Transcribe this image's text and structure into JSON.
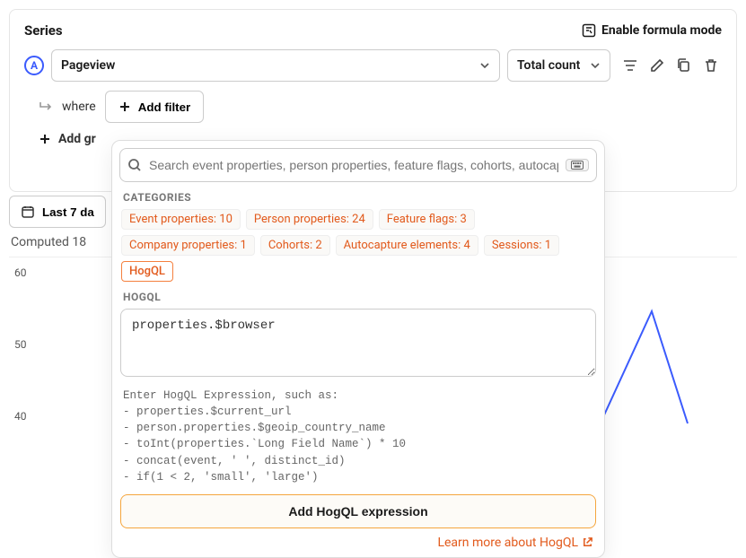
{
  "panel": {
    "title": "Series",
    "formula_link": "Enable formula mode"
  },
  "series": {
    "badge": "A",
    "event": "Pageview",
    "aggregate": "Total count"
  },
  "filter": {
    "where_label": "where",
    "add_filter_label": "Add filter",
    "add_group_label": "Add gr"
  },
  "popover": {
    "search_placeholder": "Search event properties, person properties, feature flags, cohorts, autocap",
    "categories_label": "CATEGORIES",
    "chips": [
      "Event properties: 10",
      "Person properties: 24",
      "Feature flags: 3",
      "Company properties: 1",
      "Cohorts: 2",
      "Autocapture elements: 4",
      "Sessions: 1",
      "HogQL"
    ],
    "active_chip_index": 7,
    "hogql_label": "HOGQL",
    "hogql_value": "properties.$browser",
    "hint": "Enter HogQL Expression, such as:\n- properties.$current_url\n- person.properties.$geoip_country_name\n- toInt(properties.`Long Field Name`) * 10\n- concat(event, ' ', distinct_id)\n- if(1 < 2, 'small', 'large')",
    "add_button": "Add HogQL expression",
    "learn_more": "Learn more about HogQL"
  },
  "lower": {
    "date_range_truncated": "Last 7 da",
    "computed_truncated": "Computed 18"
  },
  "chart_data": {
    "type": "line",
    "ylabel": "",
    "xlabel": "",
    "y_ticks_visible": [
      60,
      50,
      40
    ],
    "note": "Chart mostly obscured by popover; peak visible on right side",
    "series": [
      {
        "name": "A",
        "color": "#3b5bfd",
        "peak_estimate": 62
      }
    ]
  }
}
